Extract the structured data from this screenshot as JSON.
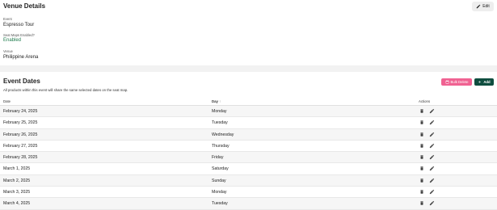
{
  "venue": {
    "title": "Venue Details",
    "edit_label": "Edit",
    "event_label": "Event",
    "event_value": "Espresso Tour",
    "seatmaps_label": "Seat Maps Enabled?",
    "seatmaps_value": "Enabled",
    "venue_label": "Venue",
    "venue_value": "Philippine Arena"
  },
  "event_dates": {
    "title": "Event Dates",
    "subtitle": "All products within this event will share the same selected dates on the seat map.",
    "bulk_delete_label": "Bulk Delete",
    "add_label": "Add",
    "columns": {
      "date": "Date",
      "day": "Day",
      "sort_indicator": "↑",
      "actions": "Actions"
    },
    "rows": [
      {
        "date": "February 24, 2025",
        "day": "Monday"
      },
      {
        "date": "February 25, 2025",
        "day": "Tuesday"
      },
      {
        "date": "February 26, 2025",
        "day": "Wednesday"
      },
      {
        "date": "February 27, 2025",
        "day": "Thursday"
      },
      {
        "date": "February 28, 2025",
        "day": "Friday"
      },
      {
        "date": "March 1, 2025",
        "day": "Saturday"
      },
      {
        "date": "March 2, 2025",
        "day": "Sunday"
      },
      {
        "date": "March 3, 2025",
        "day": "Monday"
      },
      {
        "date": "March 4, 2025",
        "day": "Tuesday"
      }
    ]
  },
  "colors": {
    "accent_green": "#1d7a4c",
    "add_button": "#0f4d3f",
    "bulk_delete": "#f06292"
  },
  "icons": {
    "edit": "pencil-icon",
    "delete": "trash-icon",
    "bulk_delete": "calendar-icon",
    "add": "plus-icon"
  }
}
